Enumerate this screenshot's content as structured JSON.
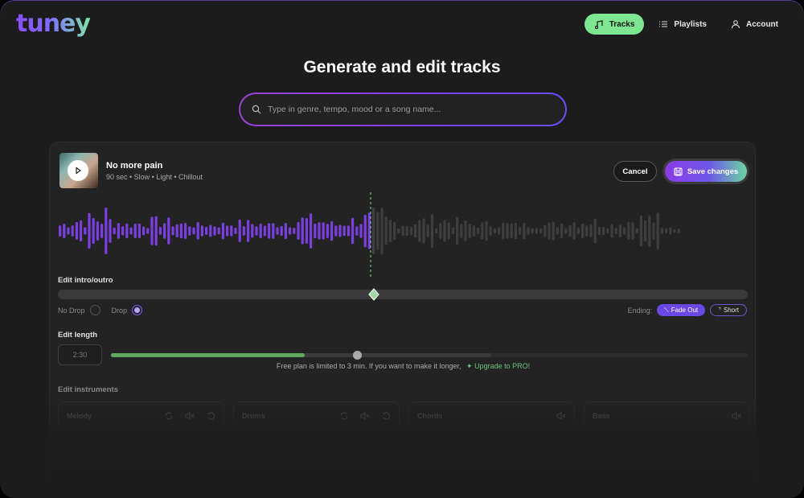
{
  "header": {
    "logo": "tuney",
    "nav": [
      {
        "label": "Tracks",
        "icon": "music-note-icon",
        "active": true
      },
      {
        "label": "Playlists",
        "icon": "list-icon",
        "active": false
      },
      {
        "label": "Account",
        "icon": "user-icon",
        "active": false
      }
    ]
  },
  "page": {
    "title": "Generate and edit tracks",
    "search_placeholder": "Type in genre, tempo, mood or a song name..."
  },
  "track": {
    "title": "No more pain",
    "meta": "90 sec • Slow • Light • Chillout",
    "cancel_label": "Cancel",
    "save_label": "Save changes"
  },
  "waveform": {
    "played_color": "#7b3fe0",
    "unplayed_color": "#3e3e3e",
    "playhead_color": "#6ee08a",
    "played_fraction": 0.5
  },
  "intro": {
    "label": "Edit intro/outro",
    "no_drop_label": "No Drop",
    "drop_label": "Drop",
    "drop_selected": true,
    "ending_label": "Ending:",
    "ending_options": [
      "Fade Out",
      "Short"
    ],
    "ending_selected": "Fade Out"
  },
  "length": {
    "label": "Edit length",
    "value": "2:30",
    "plan_note": "Free plan is limited to 3 min. If you want to make it longer,",
    "upgrade_label": "Upgrade to PRO!"
  },
  "instruments": {
    "label": "Edit instruments",
    "items": [
      {
        "name": "Melody"
      },
      {
        "name": "Drums"
      },
      {
        "name": "Chords"
      },
      {
        "name": "Bass"
      }
    ]
  },
  "colors": {
    "accent_green": "#7ee690",
    "accent_purple": "#7a44ff"
  }
}
